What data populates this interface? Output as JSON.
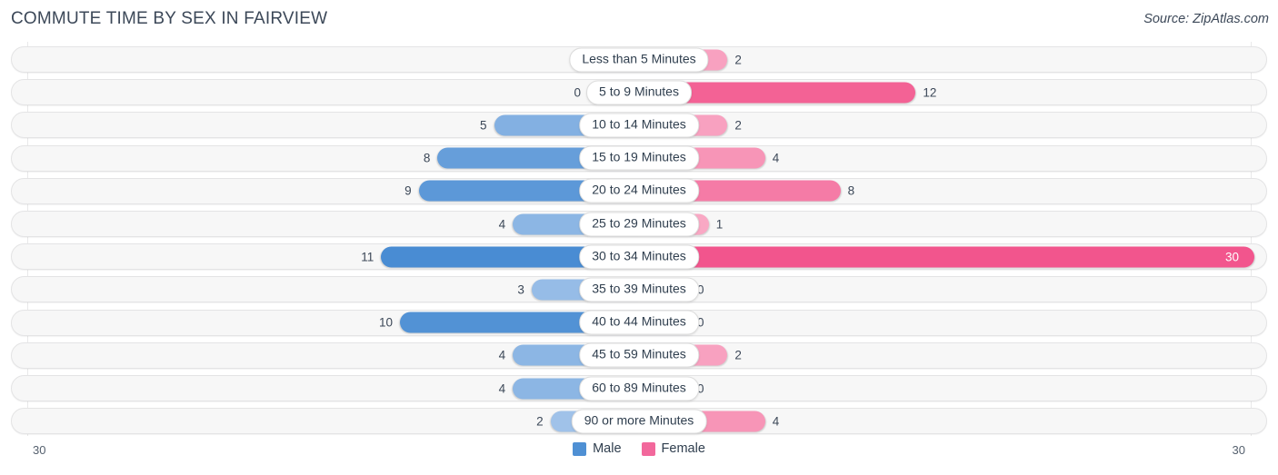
{
  "header": {
    "title": "COMMUTE TIME BY SEX IN FAIRVIEW",
    "source": "Source: ZipAtlas.com"
  },
  "legend": {
    "male_label": "Male",
    "female_label": "Female",
    "male_color": "#4f90d4",
    "female_color": "#f2689c"
  },
  "axis": {
    "left_label": "30",
    "right_label": "30"
  },
  "chart_data": {
    "type": "bar",
    "subtype": "diverging-horizontal-bar",
    "title": "COMMUTE TIME BY SEX IN FAIRVIEW",
    "xlabel": "",
    "ylabel": "",
    "xlim": [
      30,
      30
    ],
    "axis_max_per_side": 30,
    "grid": false,
    "legend_position": "bottom-center",
    "categories": [
      "Less than 5 Minutes",
      "5 to 9 Minutes",
      "10 to 14 Minutes",
      "15 to 19 Minutes",
      "20 to 24 Minutes",
      "25 to 29 Minutes",
      "30 to 34 Minutes",
      "35 to 39 Minutes",
      "40 to 44 Minutes",
      "45 to 59 Minutes",
      "60 to 89 Minutes",
      "90 or more Minutes"
    ],
    "series": [
      {
        "name": "Male",
        "side": "left",
        "color": "#4f90d4",
        "values": [
          0,
          0,
          5,
          8,
          9,
          4,
          11,
          3,
          10,
          4,
          4,
          2
        ]
      },
      {
        "name": "Female",
        "side": "right",
        "color": "#f2689c",
        "values": [
          2,
          12,
          2,
          4,
          8,
          1,
          30,
          0,
          0,
          2,
          0,
          4
        ]
      }
    ]
  },
  "rows": [
    {
      "category": "Less than 5 Minutes",
      "male": 0,
      "male_text": "0",
      "female": 2,
      "female_text": "2"
    },
    {
      "category": "5 to 9 Minutes",
      "male": 0,
      "male_text": "0",
      "female": 12,
      "female_text": "12"
    },
    {
      "category": "10 to 14 Minutes",
      "male": 5,
      "male_text": "5",
      "female": 2,
      "female_text": "2"
    },
    {
      "category": "15 to 19 Minutes",
      "male": 8,
      "male_text": "8",
      "female": 4,
      "female_text": "4"
    },
    {
      "category": "20 to 24 Minutes",
      "male": 9,
      "male_text": "9",
      "female": 8,
      "female_text": "8"
    },
    {
      "category": "25 to 29 Minutes",
      "male": 4,
      "male_text": "4",
      "female": 1,
      "female_text": "1"
    },
    {
      "category": "30 to 34 Minutes",
      "male": 11,
      "male_text": "11",
      "female": 30,
      "female_text": "30"
    },
    {
      "category": "35 to 39 Minutes",
      "male": 3,
      "male_text": "3",
      "female": 0,
      "female_text": "0"
    },
    {
      "category": "40 to 44 Minutes",
      "male": 10,
      "male_text": "10",
      "female": 0,
      "female_text": "0"
    },
    {
      "category": "45 to 59 Minutes",
      "male": 4,
      "male_text": "4",
      "female": 2,
      "female_text": "2"
    },
    {
      "category": "60 to 89 Minutes",
      "male": 4,
      "male_text": "4",
      "female": 0,
      "female_text": "0"
    },
    {
      "category": "90 or more Minutes",
      "male": 2,
      "male_text": "2",
      "female": 4,
      "female_text": "4"
    }
  ]
}
